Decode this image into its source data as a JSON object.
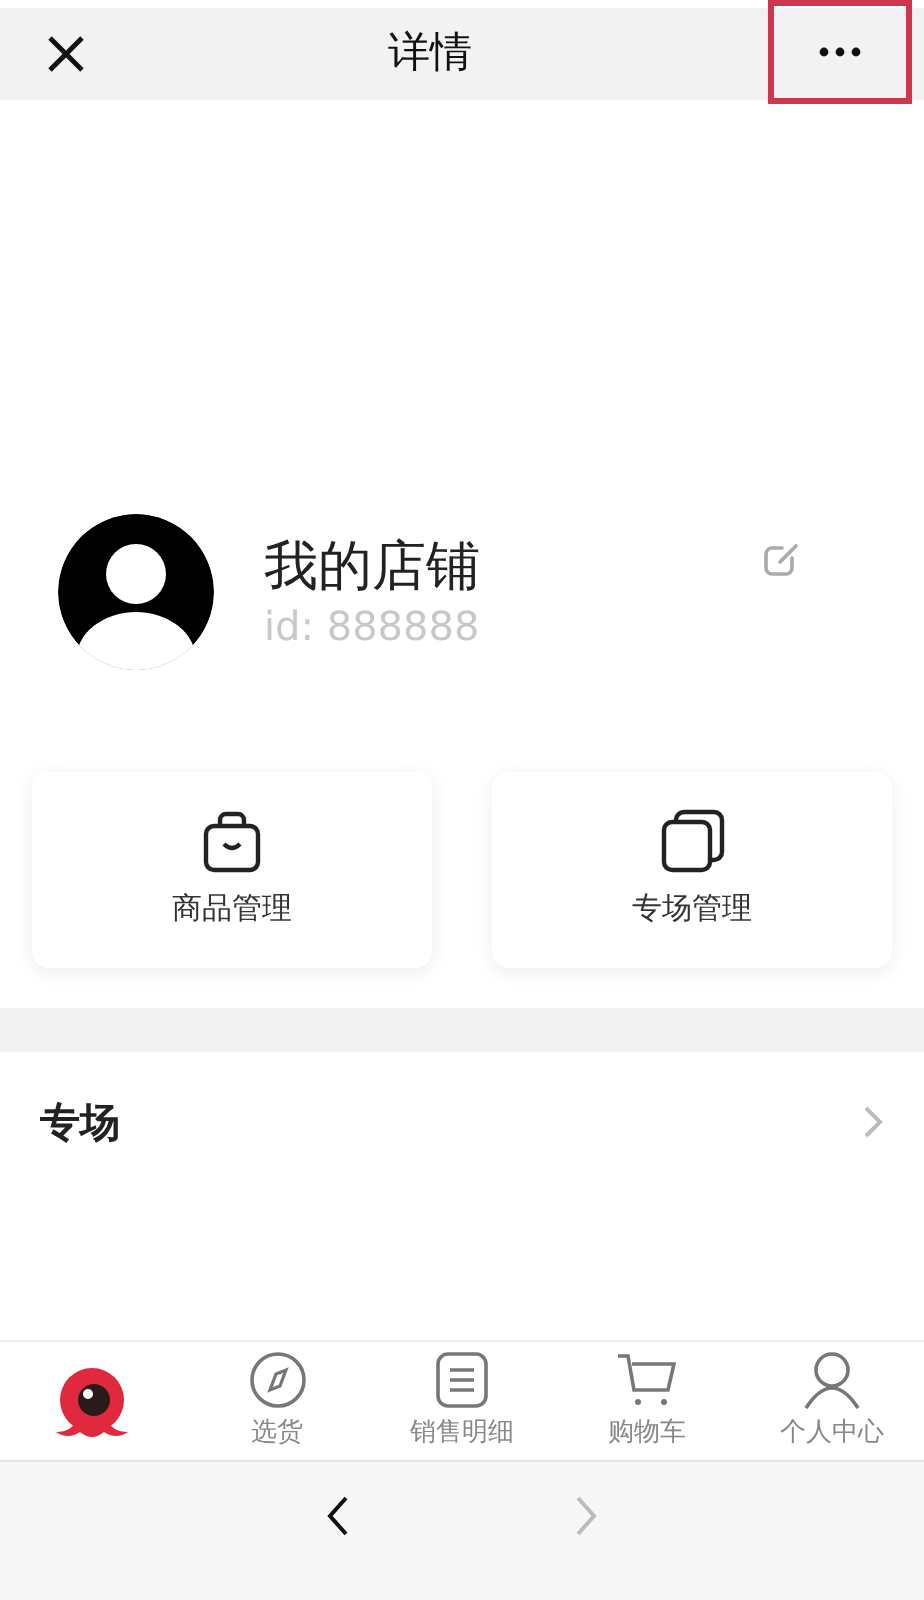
{
  "header": {
    "title": "详情",
    "more_highlighted": true
  },
  "profile": {
    "name": "我的店铺",
    "id": "id: 888888"
  },
  "cards": [
    {
      "kind": "bag",
      "label": "商品管理"
    },
    {
      "kind": "pages",
      "label": "专场管理"
    }
  ],
  "section": {
    "title": "专场"
  },
  "tabs": [
    {
      "kind": "logo",
      "selected": true
    },
    {
      "kind": "compass",
      "label": "选货",
      "selected": false
    },
    {
      "kind": "list",
      "label": "销售明细",
      "selected": false
    },
    {
      "kind": "cart",
      "label": "购物车",
      "selected": false
    },
    {
      "kind": "person",
      "label": "个人中心",
      "selected": false
    }
  ],
  "browser": {
    "back_disabled": false,
    "forward_disabled": true
  }
}
